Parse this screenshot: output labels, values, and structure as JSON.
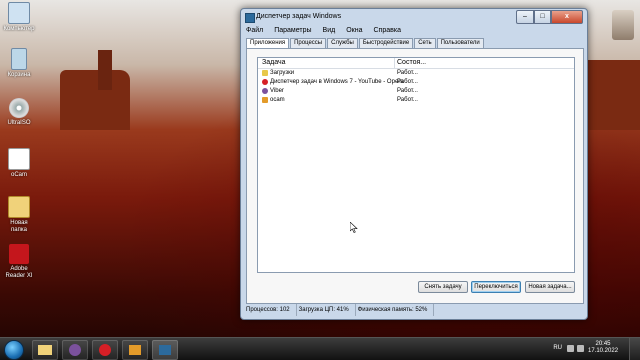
{
  "desktop": {
    "icons": [
      {
        "label": "Компьютер",
        "color": "#cfe2f2"
      },
      {
        "label": "Корзина",
        "color": "#bcd7e8"
      },
      {
        "label": "UltraISO",
        "color": "#c9c9d9"
      },
      {
        "label": "oCam",
        "color": "#ffffff"
      },
      {
        "label": "Новая папка",
        "color": "#f0d27a"
      },
      {
        "label": "Adobe Reader XI",
        "color": "#c4161c"
      }
    ]
  },
  "window": {
    "title": "Диспетчер задач Windows",
    "minimize_glyph": "–",
    "maximize_glyph": "□",
    "close_glyph": "x",
    "menu": [
      "Файл",
      "Параметры",
      "Вид",
      "Окна",
      "Справка"
    ],
    "tabs": [
      "Приложения",
      "Процессы",
      "Службы",
      "Быстродействие",
      "Сеть",
      "Пользователи"
    ],
    "active_tab_index": 0,
    "list": {
      "columns": [
        "Задача",
        "Состоя..."
      ],
      "rows": [
        {
          "name": "Загрузки",
          "status": "Работ...",
          "icon": "folder-icon",
          "icon_color": "#e8c84a"
        },
        {
          "name": "Диспетчер задач в Windows 7 - YouTube - Opera",
          "status": "Работ...",
          "icon": "opera-icon",
          "icon_color": "#d61f26"
        },
        {
          "name": "Viber",
          "status": "Работ...",
          "icon": "viber-icon",
          "icon_color": "#7b519d"
        },
        {
          "name": "ocam",
          "status": "Работ...",
          "icon": "ocam-icon",
          "icon_color": "#e39b2a"
        }
      ]
    },
    "buttons": {
      "end_task": "Снять задачу",
      "switch_to": "Переключиться",
      "new_task": "Новая задача..."
    },
    "status": {
      "processes": "Процессов: 102",
      "cpu": "Загрузка ЦП: 41%",
      "memory": "Физическая память: 52%"
    }
  },
  "taskbar": {
    "language": "RU",
    "time": "20:45",
    "date": "17.10.2022"
  }
}
